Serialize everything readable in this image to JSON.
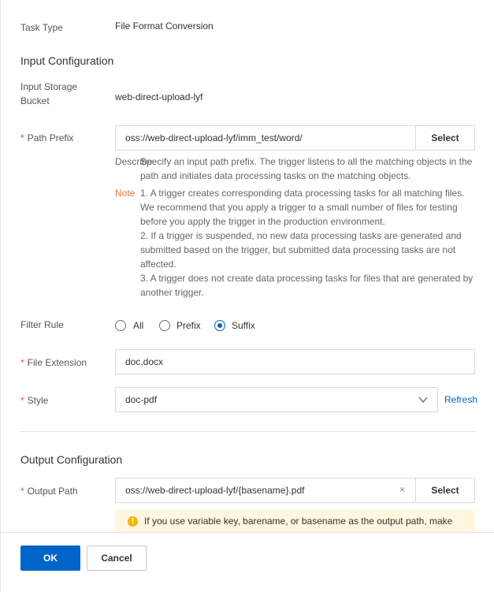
{
  "task_type": {
    "label": "Task Type",
    "value": "File Format Conversion"
  },
  "input_config": {
    "title": "Input Configuration",
    "storage_bucket": {
      "label_line1": "Input Storage",
      "label_line2": "Bucket",
      "value": "web-direct-upload-lyf"
    },
    "path_prefix": {
      "required_mark": "*",
      "label": "Path Prefix",
      "value": "oss://web-direct-upload-lyf/imm_test/word/",
      "select_label": "Select"
    },
    "describe": {
      "label": "Describe",
      "line1": "Specify an input path prefix. The trigger listens to all the matching objects in the",
      "line2": "path and initiates data processing tasks on the matching objects."
    },
    "note": {
      "label": "Note",
      "lines": [
        "1. A trigger creates corresponding data processing tasks for all matching files.",
        "We recommend that you apply a trigger to a small number of files for testing",
        "before you apply the trigger in the production environment.",
        "2. If a trigger is suspended, no new data processing tasks are generated and",
        "submitted based on the trigger, but submitted data processing tasks are not",
        "affected.",
        "3. A trigger does not create data processing tasks for files that are generated by",
        "another trigger."
      ]
    },
    "filter_rule": {
      "label": "Filter Rule",
      "options": [
        "All",
        "Prefix",
        "Suffix"
      ],
      "selected": "Suffix"
    },
    "file_extension": {
      "required_mark": "*",
      "label": "File Extension",
      "value": "doc,docx"
    },
    "style": {
      "required_mark": "*",
      "label": "Style",
      "value": "doc-pdf",
      "refresh_label": "Refresh"
    }
  },
  "output_config": {
    "title": "Output Configuration",
    "output_path": {
      "required_mark": "*",
      "label": "Output Path",
      "value": "oss://web-direct-upload-lyf/{basename}.pdf",
      "clear_glyph": "×",
      "select_label": "Select"
    },
    "warning": {
      "icon_glyph": "!",
      "text": "If you use variable key, barename, or basename as the output path, make"
    }
  },
  "footer": {
    "ok_label": "OK",
    "cancel_label": "Cancel"
  },
  "colors": {
    "primary": "#0064c8",
    "required": "#e84738",
    "note": "#e8743b",
    "warning_bg": "#fff7e0",
    "warning_icon": "#f5b400"
  },
  "icons": {
    "dropdown": "chevron-down-icon",
    "clear": "clear-icon",
    "warning": "warning-icon"
  }
}
